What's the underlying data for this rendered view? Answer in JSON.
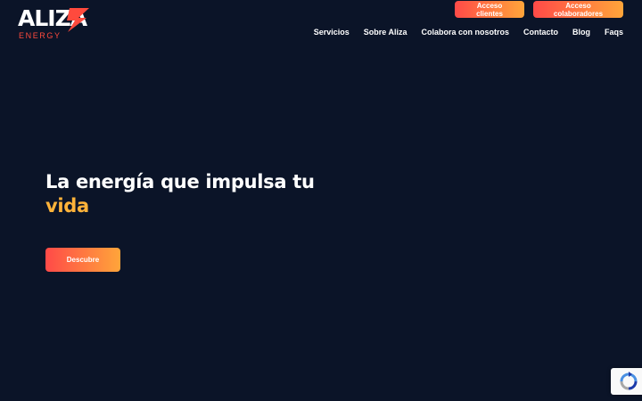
{
  "logo": {
    "word": "ALIZA",
    "sub": "ENERGY"
  },
  "top_buttons": {
    "clients": "Acceso clientes",
    "collaborators": "Acceso colaboradores"
  },
  "nav": [
    {
      "label": "Servicios"
    },
    {
      "label": "Sobre Aliza"
    },
    {
      "label": "Colabora con nosotros"
    },
    {
      "label": "Contacto"
    },
    {
      "label": "Blog"
    },
    {
      "label": "Faqs"
    }
  ],
  "hero": {
    "title_line": "La energía que impulsa tu",
    "title_accent": "vida",
    "cta": "Descubre"
  },
  "recaptcha": {
    "icon": "recaptcha-icon"
  },
  "colors": {
    "background": "#0b1428",
    "gradient_start": "#ff4a48",
    "gradient_end": "#ffa53a",
    "accent": "#ffb33a",
    "logo_red": "#ff4a3d"
  }
}
